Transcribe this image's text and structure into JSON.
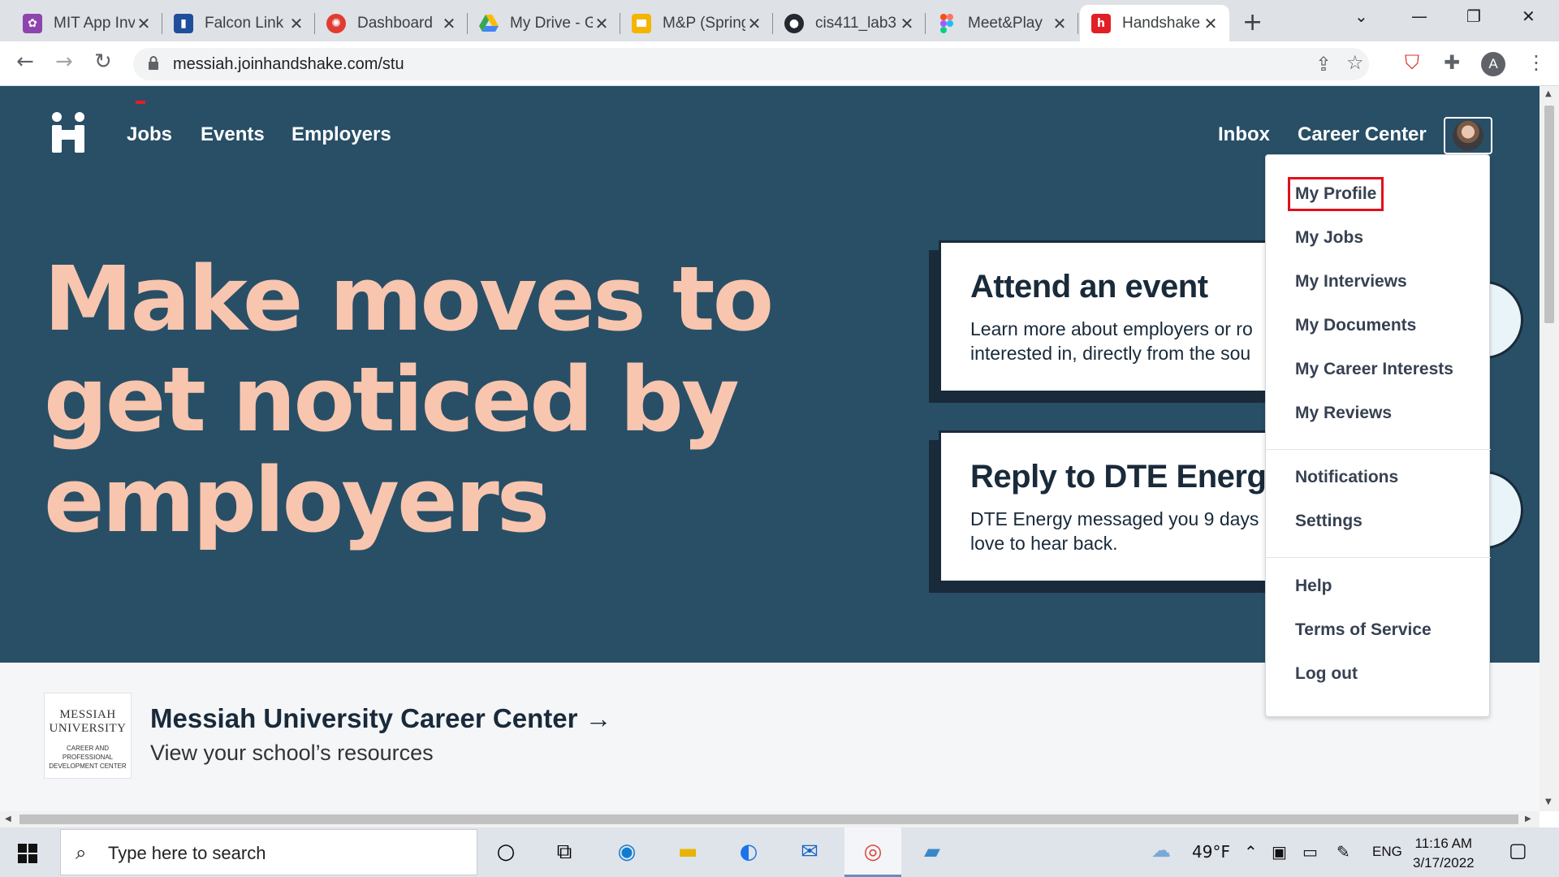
{
  "browser": {
    "tabs": [
      {
        "title": "MIT App Inv",
        "icon": "mit-app-inventor-icon",
        "color": "#8e44ad"
      },
      {
        "title": "Falcon Link",
        "icon": "falcon-link-icon",
        "color": "#1f4e9c"
      },
      {
        "title": "Dashboard",
        "icon": "canvas-dashboard-icon",
        "color": "#e03c31"
      },
      {
        "title": "My Drive - G",
        "icon": "google-drive-icon",
        "color": "#34a853"
      },
      {
        "title": "M&P (Spring",
        "icon": "google-slides-icon",
        "color": "#f4b400"
      },
      {
        "title": "cis411_lab3",
        "icon": "github-icon",
        "color": "#24292f"
      },
      {
        "title": "Meet&Play",
        "icon": "figma-icon",
        "color": "#f24e1e"
      },
      {
        "title": "Handshake",
        "icon": "handshake-icon",
        "color": "#e21f26"
      }
    ],
    "url": "messiah.joinhandshake.com/stu",
    "profile_initial": "A"
  },
  "nav": {
    "links": [
      "Jobs",
      "Events",
      "Employers"
    ],
    "inbox": "Inbox",
    "career_center": "Career Center"
  },
  "hero": {
    "headline": "Make moves to get noticed by employers",
    "cards": [
      {
        "title": "Attend an event",
        "line1": "Learn more about employers or ro",
        "line2": "interested in, directly from the sou"
      },
      {
        "title": "Reply to DTE Energ",
        "line1": "DTE Energy messaged you 9 days",
        "line2": "love to hear back."
      }
    ]
  },
  "career_center": {
    "logo_line1": "MESSIAH",
    "logo_line2": "UNIVERSITY",
    "logo_line3": "CAREER AND PROFESSIONAL DEVELOPMENT CENTER",
    "title": "Messiah University Career Center →",
    "subtitle": "View your school’s resources"
  },
  "dropdown": {
    "group1": [
      "My Profile",
      "My Jobs",
      "My Interviews",
      "My Documents",
      "My Career Interests",
      "My Reviews"
    ],
    "group2": [
      "Notifications",
      "Settings"
    ],
    "group3": [
      "Help",
      "Terms of Service",
      "Log out"
    ]
  },
  "taskbar": {
    "search_placeholder": "Type here to search",
    "weather": "49°F",
    "language": "ENG",
    "time": "11:16 AM",
    "date": "3/17/2022"
  },
  "colors": {
    "hero_bg": "#284f66",
    "headline": "#f8c5af",
    "brand_red": "#e21f26",
    "card_ink": "#192a3a"
  }
}
